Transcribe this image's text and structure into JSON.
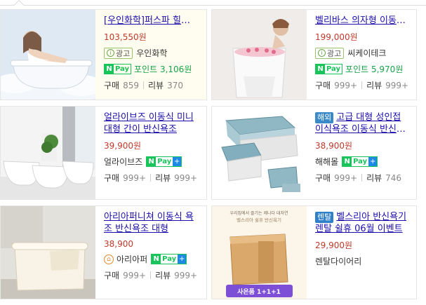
{
  "products": [
    {
      "title": "[우인화학]퍼스파 힐링 이동식 반신욕조",
      "price": "103,550원",
      "ad_label": "광고",
      "seller": "우인화학",
      "points": "포인트 3,106원",
      "purchase_label": "구매",
      "purchase_count": "859",
      "review_label": "리뷰",
      "review_count": "370"
    },
    {
      "title": "벨리바스 의자형 이동식 반신욕조",
      "price": "199,000원",
      "ad_label": "광고",
      "seller": "씨케이테크",
      "points": "포인트 5,970원",
      "purchase_label": "구매",
      "purchase_count": "999+",
      "review_label": "리뷰",
      "review_count": "999+"
    },
    {
      "title": "얼라이브즈 이동식 미니 대형 간이 반신욕조",
      "price": "39,900원",
      "seller": "얼라이브즈",
      "purchase_label": "구매",
      "purchase_count": "999+",
      "review_label": "리뷰",
      "review_count": "999+"
    },
    {
      "tag": "해외",
      "title": "고급 대형 성인접이식욕조 이동식 반신욕조",
      "price": "38,900원",
      "seller": "해해몰",
      "purchase_label": "구매",
      "purchase_count": "999+",
      "review_label": "리뷰",
      "review_count": "746"
    },
    {
      "title": "아리아퍼니쳐 이동식 욕조 반신욕조 대형",
      "price": "38,900",
      "seller": "아리아퍼",
      "purchase_label": "구매",
      "purchase_count": "999+",
      "review_label": "리뷰",
      "review_count": "999+"
    },
    {
      "tag": "렌탈",
      "title": "벨스리아 반신욕기렌탈 쉴휴 06월 이벤트",
      "price": "29,900원",
      "seller": "렌탈다이어리",
      "image_text_top": "우리집에서 즐기는 제나다 대자연",
      "image_text_mid": "벨스리아 쉴휴 반신욕기",
      "image_banner": "사은품 1+1+1"
    }
  ],
  "npay": {
    "n": "N",
    "pay": "Pay",
    "plus": "+"
  },
  "colors": {
    "link": "#1a0dab",
    "price": "#c0392b",
    "npay_green": "#19c45a",
    "points_green": "#19a34a"
  }
}
